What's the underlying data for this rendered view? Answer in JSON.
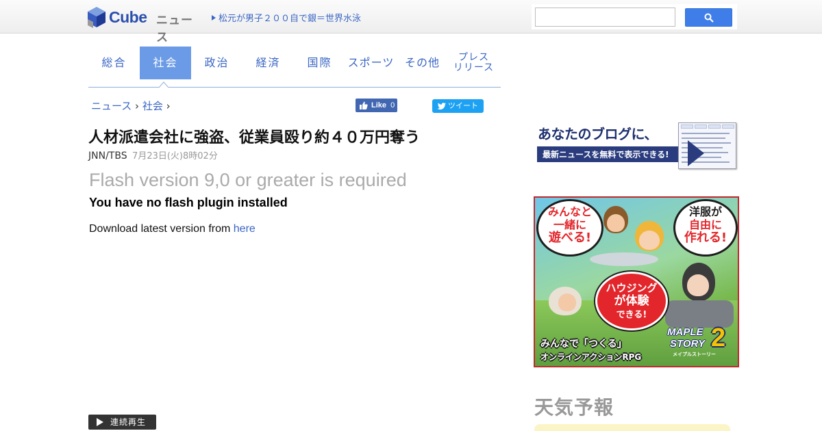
{
  "header": {
    "logo_text": "Cube",
    "logo_sub": "ニュース",
    "ticker": "松元が男子２００自で銀＝世界水泳",
    "search_placeholder": ""
  },
  "nav": {
    "items": [
      {
        "label": "総合",
        "active": false
      },
      {
        "label": "社会",
        "active": true
      },
      {
        "label": "政治",
        "active": false
      },
      {
        "label": "経済",
        "active": false
      },
      {
        "label": "国際",
        "active": false
      },
      {
        "label": "スポーツ",
        "active": false
      },
      {
        "label": "その他",
        "active": false
      },
      {
        "label_line1": "プレス",
        "label_line2": "リリース",
        "active": false
      }
    ],
    "active_color": "#6b9be6"
  },
  "breadcrumb": {
    "root": "ニュース",
    "separator": "›",
    "current": "社会"
  },
  "social": {
    "like_label": "Like",
    "like_count": "0",
    "tweet_label": "ツイート"
  },
  "article": {
    "title": "人材派遣会社に強盗、従業員殴り約４０万円奪う",
    "source": "JNN/TBS",
    "date": "7月23日(火)8時02分"
  },
  "flash": {
    "heading": "Flash version 9,0 or greater is required",
    "warning": "You have no flash plugin installed",
    "download_text": "Download latest version from",
    "download_link": "here"
  },
  "player": {
    "autoplay_label": "連続再生"
  },
  "ads": {
    "blog": {
      "line1": "あなたのブログに、",
      "line2": "最新ニュースを無料で表示できる!"
    },
    "game": {
      "bubble1_line1": "みんなと",
      "bubble1_line2": "一緒に",
      "bubble1_line3": "遊べる!",
      "bubble2_line1": "洋服が",
      "bubble2_line2": "自由に",
      "bubble2_line3": "作れる!",
      "bubble3_line1": "ハウジング",
      "bubble3_line2": "が体験",
      "bubble3_line3": "できる!",
      "tagline1": "みんなで「つくる」",
      "tagline2": "オンラインアクションRPG",
      "logo_line1": "MAPLE",
      "logo_line2": "STORY",
      "logo_number": "2",
      "logo_sub": "メイプルストーリー"
    }
  },
  "weather": {
    "title": "天気予報"
  }
}
